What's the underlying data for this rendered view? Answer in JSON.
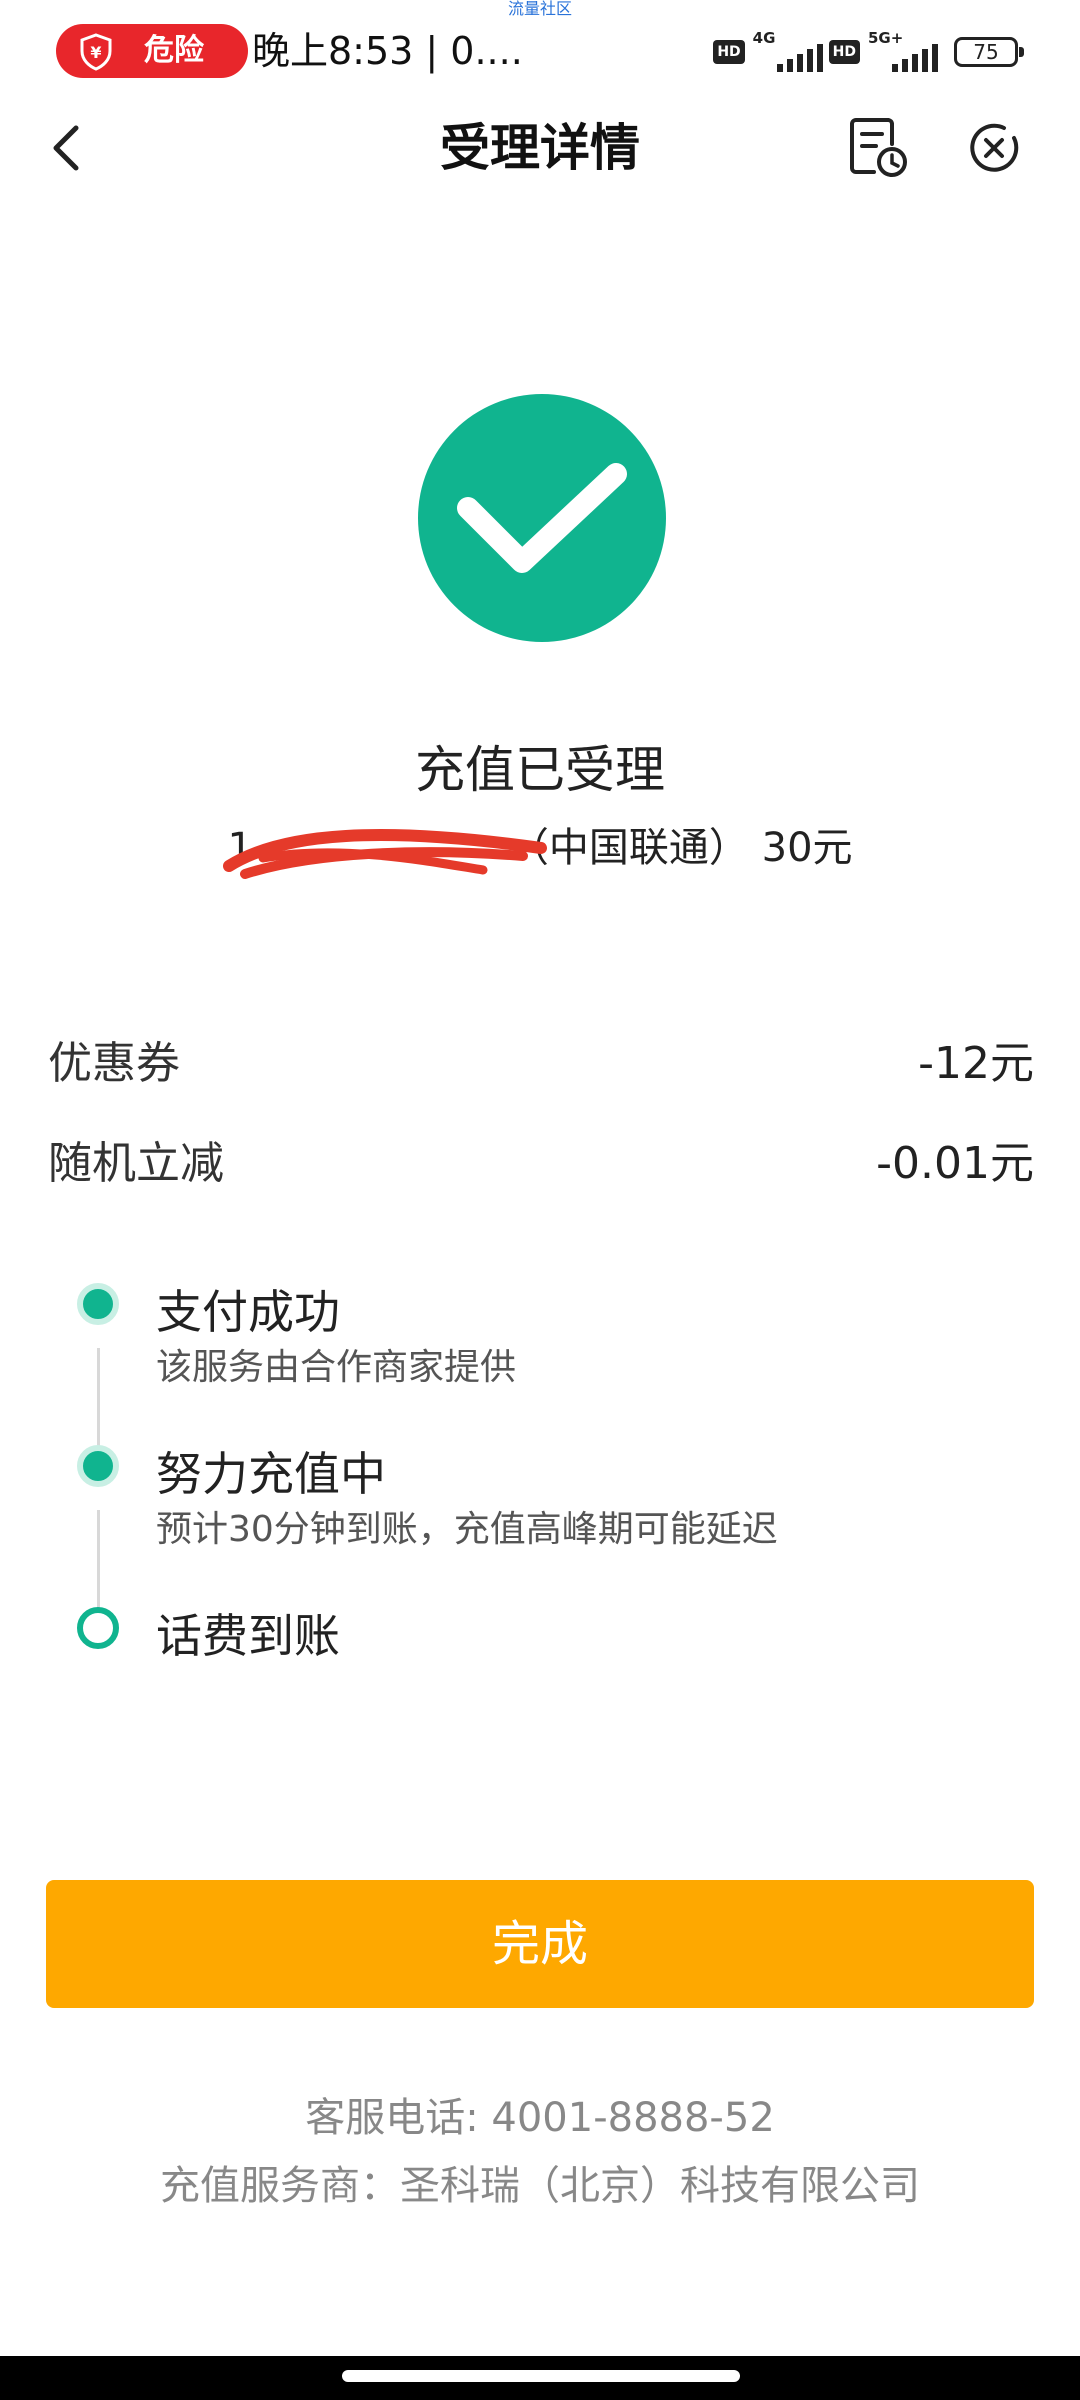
{
  "watermark": "流量社区",
  "status_bar": {
    "risk_label": "危险",
    "time_text": "晚上8:53 | 0....",
    "hd_label": "HD",
    "net1_label": "4G",
    "net2_label": "5G+",
    "battery": "75"
  },
  "nav": {
    "title": "受理详情"
  },
  "result": {
    "status_title": "充值已受理",
    "phone_masked": "1",
    "carrier_amount": "（中国联通） 30元"
  },
  "discounts": [
    {
      "label": "优惠券",
      "value": "-12元"
    },
    {
      "label": "随机立减",
      "value": "-0.01元"
    }
  ],
  "timeline": [
    {
      "title": "支付成功",
      "desc": "该服务由合作商家提供",
      "state": "done"
    },
    {
      "title": "努力充值中",
      "desc": "预计30分钟到账，充值高峰期可能延迟",
      "state": "done"
    },
    {
      "title": "话费到账",
      "desc": "",
      "state": "pending"
    }
  ],
  "done_button_label": "完成",
  "footer": {
    "service_phone": "客服电话: 4001-8888-52",
    "provider": "充值服务商：圣科瑞（北京）科技有限公司"
  },
  "colors": {
    "success_green": "#10b48f",
    "done_button": "#fea800",
    "risk_red": "#e8262b",
    "scribble_red": "#e53a2a"
  }
}
